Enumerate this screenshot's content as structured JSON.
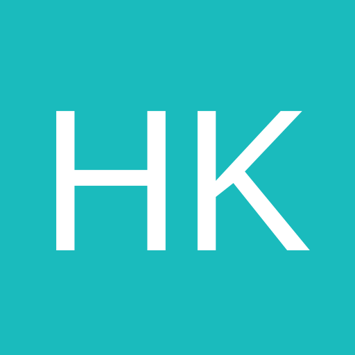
{
  "avatar": {
    "initials": "HK",
    "background_color": "#1abbbd",
    "text_color": "#ffffff"
  }
}
